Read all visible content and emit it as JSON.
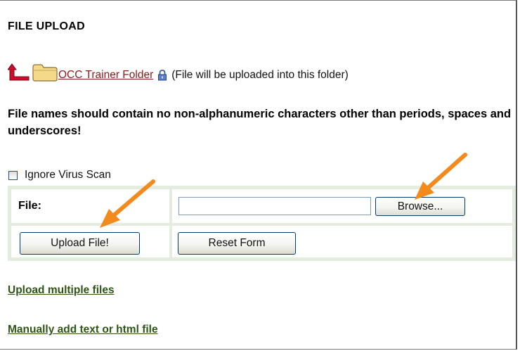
{
  "heading": "FILE UPLOAD",
  "folder": {
    "icons": [
      "up-arrow-icon",
      "folder-icon",
      "lock-icon"
    ],
    "link_text": "OCC Trainer Folder",
    "note": "(File will be uploaded into this folder)"
  },
  "warning": "File names should contain no non-alphanumeric characters other than periods, spaces and underscores!",
  "ignore_virus_scan": {
    "label": "Ignore Virus Scan",
    "checked": false
  },
  "form": {
    "file_label": "File:",
    "file_value": "",
    "browse_label": "Browse...",
    "upload_label": "Upload File!",
    "reset_label": "Reset Form"
  },
  "links": {
    "upload_multiple": "Upload multiple files",
    "manual_add": "Manually add text or html file"
  },
  "colors": {
    "callout_arrow": "#f28a1e",
    "link_green": "#2e5416",
    "folder_link": "#8b1a1a",
    "table_border": "#e3ecdf",
    "up_arrow": "#c8102e"
  }
}
